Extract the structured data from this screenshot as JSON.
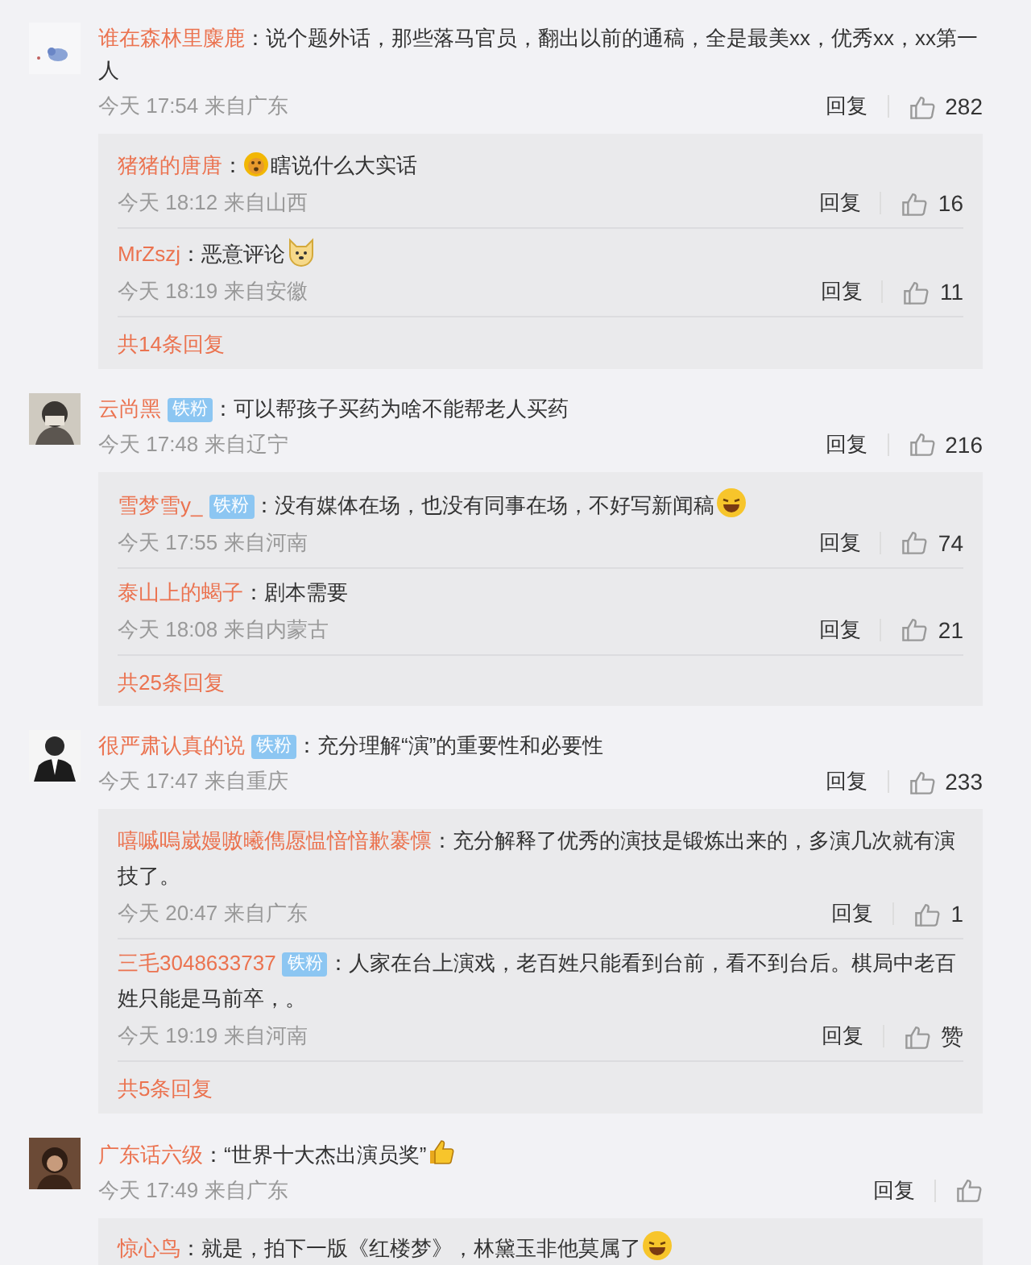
{
  "comments": [
    {
      "user": "谁在森林里麋鹿",
      "separator": "：",
      "text": "说个题外话，那些落马官员，翻出以前的通稿，全是最美xx，优秀xx，xx第一人",
      "time": "今天 17:54",
      "location": "来自广东",
      "reply_label": "回复",
      "likes": "282",
      "replies": [
        {
          "kind": "leading-emoji",
          "user": "猪猪的唐唐",
          "separator": "：",
          "text": "瞎说什么大实话",
          "time": "今天 18:12",
          "location": "来自山西",
          "reply_label": "回复",
          "likes": "16"
        },
        {
          "kind": "trailing-emoji",
          "user": "MrZszj",
          "separator": "：",
          "text": "恶意评论",
          "time": "今天 18:19",
          "location": "来自安徽",
          "reply_label": "回复",
          "likes": "11"
        }
      ],
      "more": "共14条回复"
    },
    {
      "user": "云尚黑",
      "badge": "铁粉",
      "separator": "：",
      "text": "可以帮孩子买药为啥不能帮老人买药",
      "time": "今天 17:48",
      "location": "来自辽宁",
      "reply_label": "回复",
      "likes": "216",
      "replies": [
        {
          "kind": "trailing-emoji",
          "user": "雪梦雪y_",
          "badge": "铁粉",
          "separator": "：",
          "text": "没有媒体在场，也没有同事在场，不好写新闻稿",
          "time": "今天 17:55",
          "location": "来自河南",
          "reply_label": "回复",
          "likes": "74"
        },
        {
          "user": "泰山上的蝎子",
          "separator": "：",
          "text": "剧本需要",
          "time": "今天 18:08",
          "location": "来自内蒙古",
          "reply_label": "回复",
          "likes": "21"
        }
      ],
      "more": "共25条回复"
    },
    {
      "user": "很严肃认真的说",
      "badge": "铁粉",
      "separator": "：",
      "text": "充分理解“演”的重要性和必要性",
      "time": "今天 17:47",
      "location": "来自重庆",
      "reply_label": "回复",
      "likes": "233",
      "replies": [
        {
          "user": "嘻嘁嗚崴嫚嗷曦儁愿愠愔愔歉褰懔",
          "separator": "：",
          "text": "充分解释了优秀的演技是锻炼出来的，多演几次就有演技了。",
          "time": "今天 20:47",
          "location": "来自广东",
          "reply_label": "回复",
          "likes": "1"
        },
        {
          "user": "三毛3048633737",
          "badge": "铁粉",
          "separator": "：",
          "text": "人家在台上演戏，老百姓只能看到台前，看不到台后。棋局中老百姓只能是马前卒，。",
          "time": "今天 19:19",
          "location": "来自河南",
          "reply_label": "回复",
          "likes": "赞"
        }
      ],
      "more": "共5条回复"
    },
    {
      "kind": "trailing-emoji",
      "user": "广东话六级",
      "separator": "：",
      "text": "“世界十大杰出演员奖”",
      "time": "今天 17:49",
      "location": "来自广东",
      "reply_label": "回复",
      "replies": [
        {
          "kind": "trailing-emoji",
          "user": "惊心鸟",
          "separator": "：",
          "text": "就是，拍下一版《红楼梦》，林黛玉非他莫属了"
        }
      ]
    }
  ]
}
